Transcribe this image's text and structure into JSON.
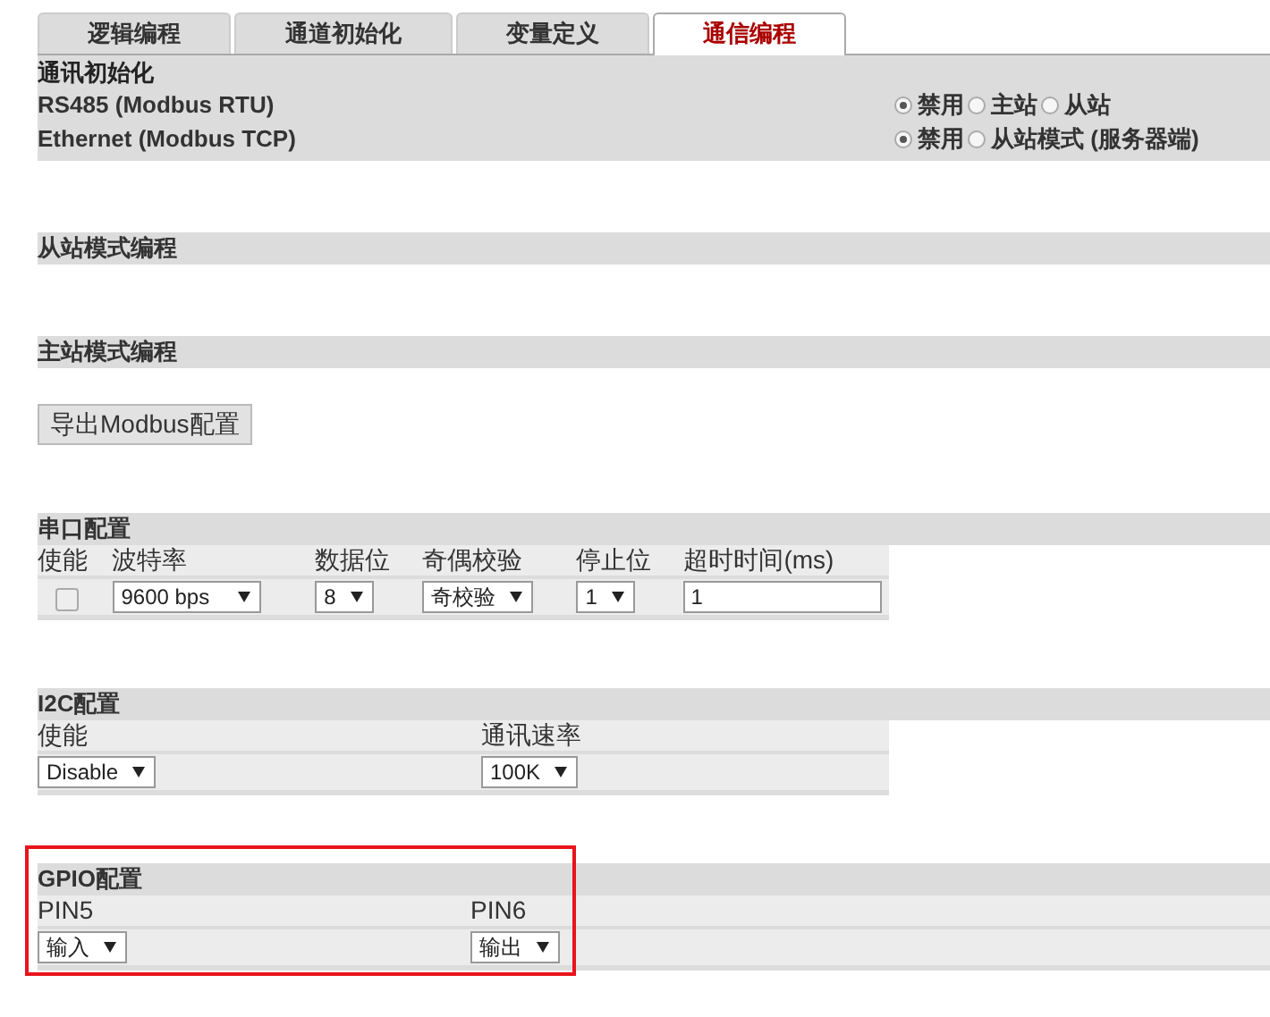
{
  "tabs": [
    {
      "label": "逻辑编程",
      "selected": false
    },
    {
      "label": "通道初始化",
      "selected": false
    },
    {
      "label": "变量定义",
      "selected": false
    },
    {
      "label": "通信编程",
      "selected": true
    }
  ],
  "sections": [
    {
      "kind": "radios",
      "title": "通讯初始化",
      "rows": [
        {
          "label": "RS485 (Modbus RTU)",
          "options": [
            {
              "label": "禁用",
              "selected": true
            },
            {
              "label": "主站",
              "selected": false
            },
            {
              "label": "从站",
              "selected": false
            }
          ]
        },
        {
          "label": "Ethernet (Modbus TCP)",
          "options": [
            {
              "label": "禁用",
              "selected": true
            },
            {
              "label": "从站模式 (服务器端)",
              "selected": false
            }
          ]
        }
      ]
    },
    {
      "kind": "empty",
      "title": "从站模式编程"
    },
    {
      "kind": "actions",
      "title": "主站模式编程",
      "buttons": [
        "导出Modbus配置"
      ]
    },
    {
      "kind": "table",
      "title": "串口配置",
      "highlighted": false,
      "columns": [
        "使能",
        "波特率",
        "数据位",
        "奇偶校验",
        "停止位",
        "超时时间(ms)"
      ],
      "cells": [
        {
          "kind": "checkbox",
          "checked": false
        },
        {
          "kind": "select",
          "value": "9600 bps"
        },
        {
          "kind": "select",
          "value": "8"
        },
        {
          "kind": "select",
          "value": "奇校验"
        },
        {
          "kind": "select",
          "value": "1"
        },
        {
          "kind": "input",
          "value": "1"
        }
      ]
    },
    {
      "kind": "table",
      "title": "I2C配置",
      "highlighted": false,
      "columns": [
        "使能",
        "通讯速率"
      ],
      "cells": [
        {
          "kind": "select",
          "value": "Disable"
        },
        {
          "kind": "select",
          "value": "100K"
        }
      ]
    },
    {
      "kind": "table",
      "title": "GPIO配置",
      "highlighted": true,
      "columns": [
        "PIN5",
        "PIN6"
      ],
      "cells": [
        {
          "kind": "select",
          "value": "输入"
        },
        {
          "kind": "select",
          "value": "输出"
        }
      ]
    }
  ]
}
